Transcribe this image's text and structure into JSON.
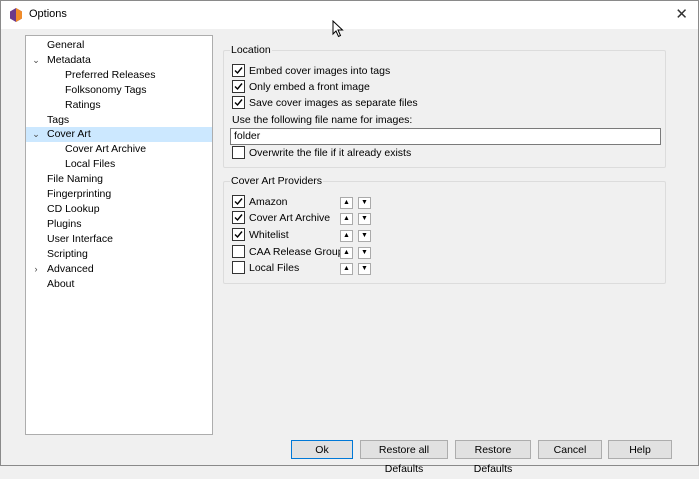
{
  "window": {
    "title": "Options"
  },
  "sidebar": {
    "items": [
      {
        "label": "General"
      },
      {
        "label": "Metadata"
      },
      {
        "label": "Preferred Releases"
      },
      {
        "label": "Folksonomy Tags"
      },
      {
        "label": "Ratings"
      },
      {
        "label": "Tags"
      },
      {
        "label": "Cover Art"
      },
      {
        "label": "Cover Art Archive"
      },
      {
        "label": "Local Files"
      },
      {
        "label": "File Naming"
      },
      {
        "label": "Fingerprinting"
      },
      {
        "label": "CD Lookup"
      },
      {
        "label": "Plugins"
      },
      {
        "label": "User Interface"
      },
      {
        "label": "Scripting"
      },
      {
        "label": "Advanced"
      },
      {
        "label": "About"
      }
    ]
  },
  "location": {
    "title": "Location",
    "embed_cover": {
      "label": "Embed cover images into tags",
      "checked": true
    },
    "only_front": {
      "label": "Only embed a front image",
      "checked": true
    },
    "save_separate": {
      "label": "Save cover images as separate files",
      "checked": true
    },
    "filename_label": "Use the following file name for images:",
    "filename_value": "folder",
    "overwrite": {
      "label": "Overwrite the file if it already exists",
      "checked": false
    }
  },
  "providers": {
    "title": "Cover Art Providers",
    "items": [
      {
        "label": "Amazon",
        "checked": true
      },
      {
        "label": "Cover Art Archive",
        "checked": true
      },
      {
        "label": "Whitelist",
        "checked": true
      },
      {
        "label": "CAA Release Group",
        "checked": false
      },
      {
        "label": "Local Files",
        "checked": false
      }
    ]
  },
  "buttons": {
    "ok": "Ok",
    "restore_all": "Restore all Defaults",
    "restore": "Restore Defaults",
    "cancel": "Cancel",
    "help": "Help"
  },
  "icons": {
    "app": "picard-logo-icon",
    "close": "close-icon",
    "move_up": "triangle-up-icon",
    "move_down": "triangle-down-icon"
  },
  "colors": {
    "selection": "#cce8ff",
    "default_button_border": "#0078d7",
    "logo_orange": "#f08c2a",
    "logo_purple": "#6b3a8c"
  }
}
